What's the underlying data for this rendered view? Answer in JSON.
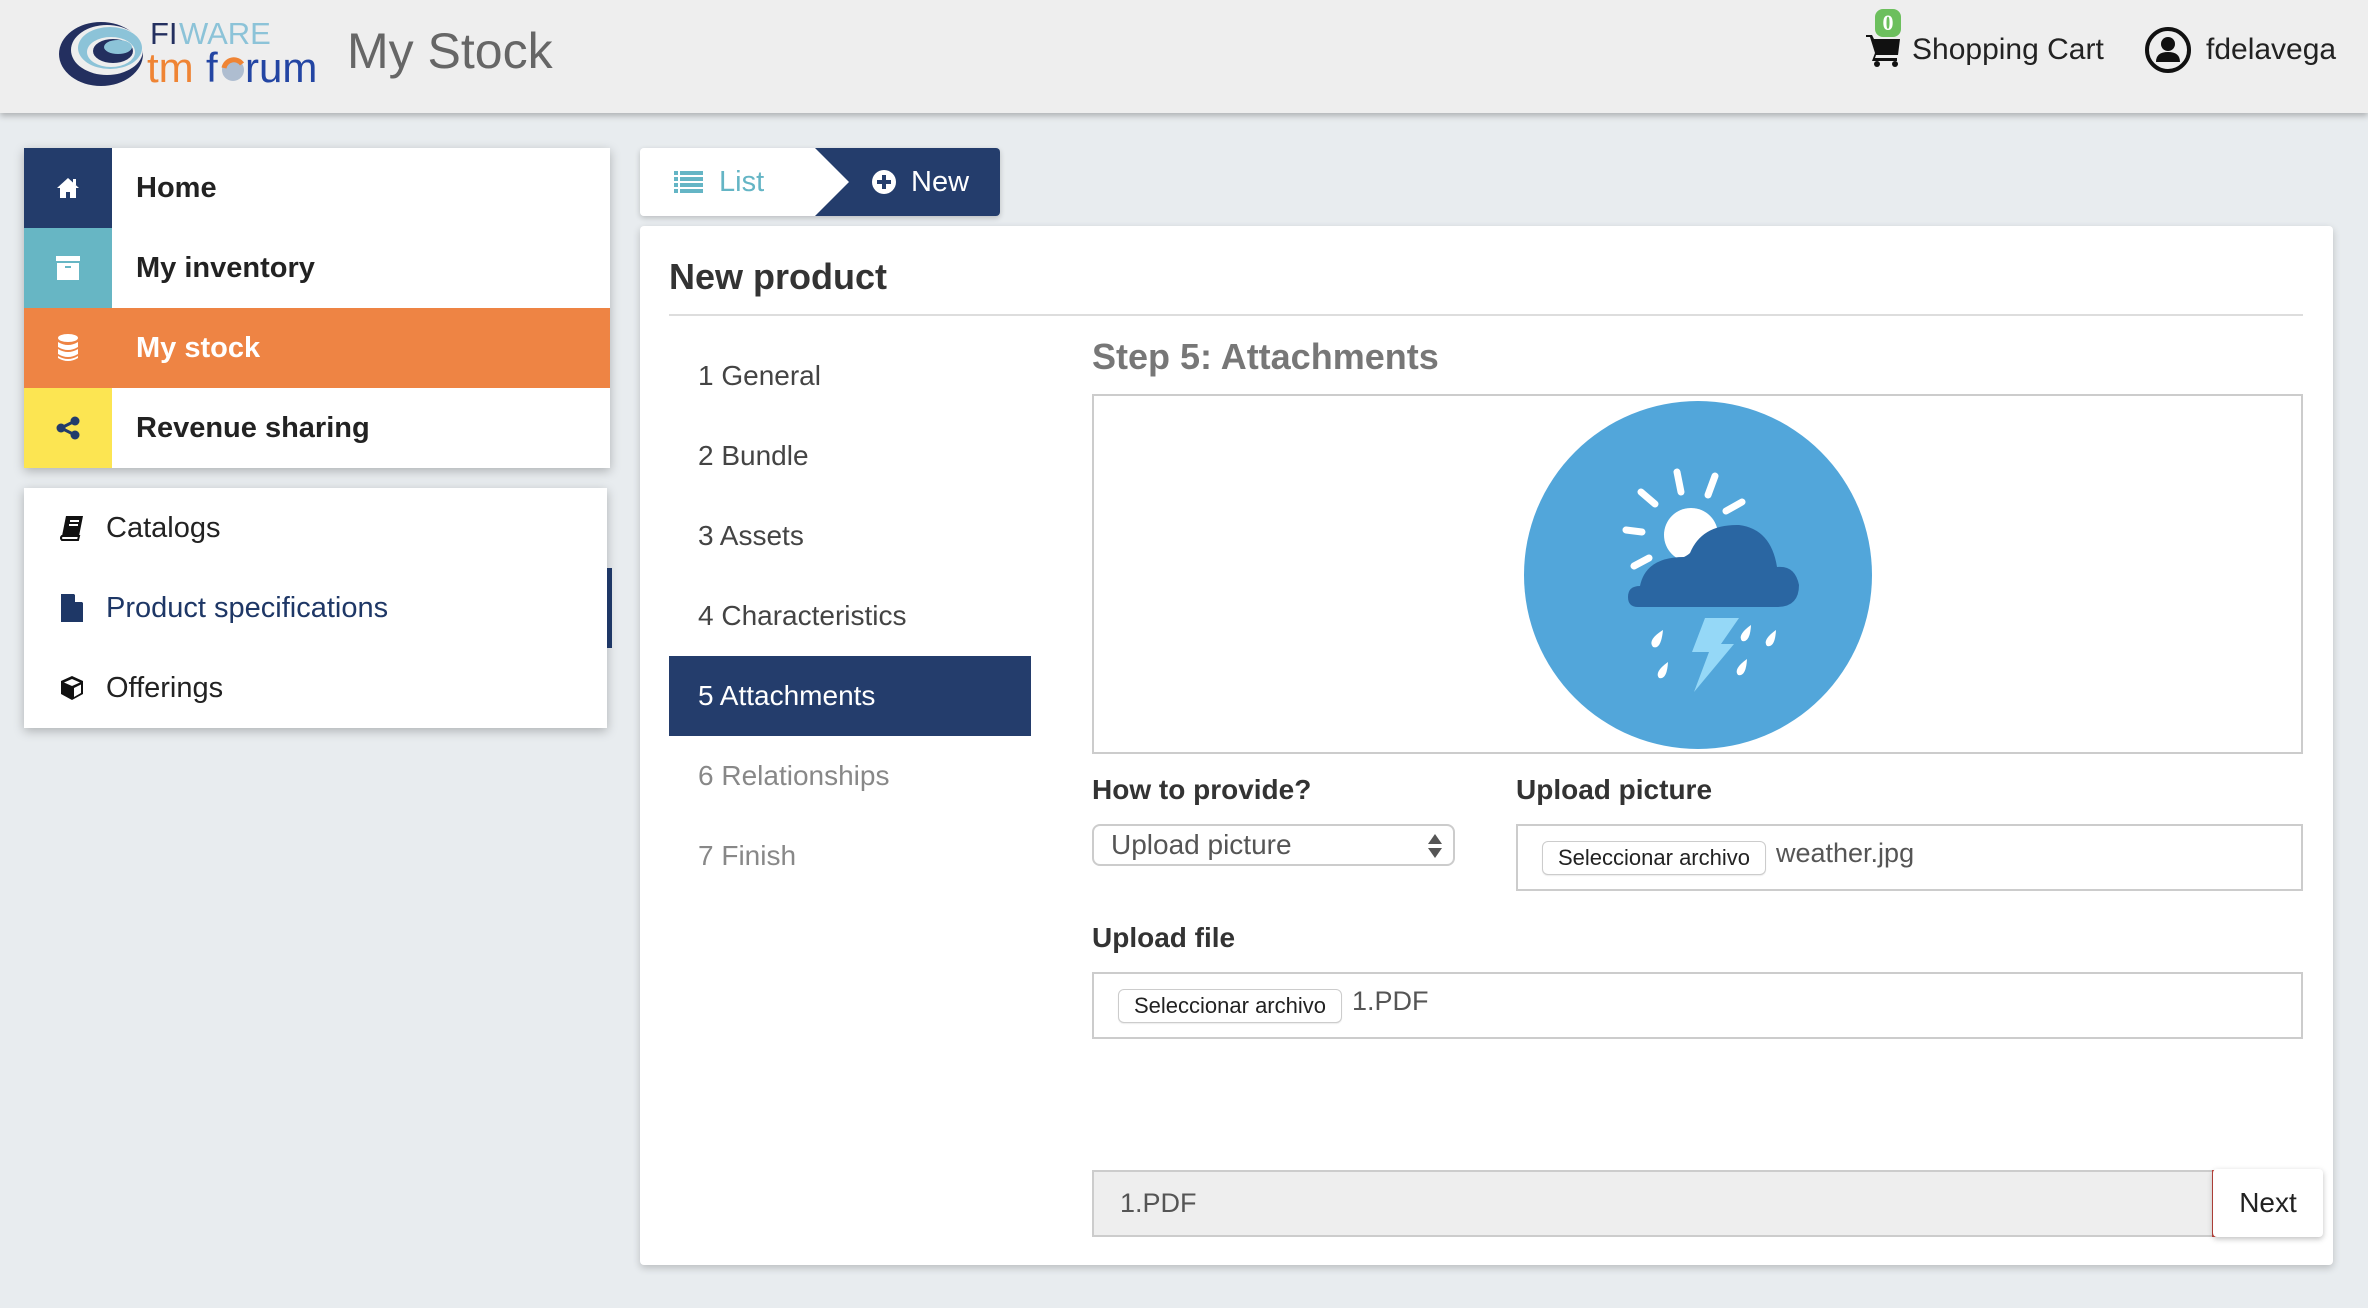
{
  "header": {
    "brand_top": "FIWARE",
    "brand_bottom": "tmforum",
    "app_title": "My Stock",
    "cart": {
      "label": "Shopping Cart",
      "count": "0",
      "icon": "shopping-cart-icon"
    },
    "user": {
      "name": "fdelavega",
      "icon": "user-circle-icon"
    }
  },
  "sidebar": {
    "main_items": [
      {
        "label": "Home",
        "icon": "home-icon",
        "color": "#233c6b"
      },
      {
        "label": "My inventory",
        "icon": "archive-box-icon",
        "color": "#67b6c4"
      },
      {
        "label": "My stock",
        "icon": "database-icon",
        "color": "#ee8444",
        "active": true
      },
      {
        "label": "Revenue sharing",
        "icon": "share-icon",
        "color": "#fce552"
      }
    ],
    "sub_items": [
      {
        "label": "Catalogs",
        "icon": "book-icon"
      },
      {
        "label": "Product specifications",
        "icon": "file-icon",
        "active": true
      },
      {
        "label": "Offerings",
        "icon": "cube-icon"
      }
    ]
  },
  "tabs": {
    "list_label": "List",
    "new_label": "New"
  },
  "panel": {
    "title": "New product",
    "steps": [
      {
        "label": "1  General",
        "state": "done"
      },
      {
        "label": "2  Bundle",
        "state": "done"
      },
      {
        "label": "3  Assets",
        "state": "done"
      },
      {
        "label": "4  Characteristics",
        "state": "done"
      },
      {
        "label": "5  Attachments",
        "state": "active"
      },
      {
        "label": "6  Relationships",
        "state": "pending"
      },
      {
        "label": "7  Finish",
        "state": "pending"
      }
    ],
    "step_title": "Step 5: Attachments",
    "preview_alt": "weather-storm-image",
    "how_label": "How to provide?",
    "how_value": "Upload picture",
    "upload_picture_label": "Upload picture",
    "upload_picture_button": "Seleccionar archivo",
    "upload_picture_file": "weather.jpg",
    "upload_file_label": "Upload file",
    "upload_file_button": "Seleccionar archivo",
    "upload_file_file": "1.PDF",
    "attachments": [
      {
        "name": "1.PDF"
      }
    ],
    "next_label": "Next"
  },
  "colors": {
    "navy": "#243d6c",
    "orange": "#ee8444",
    "teal": "#67b6c4",
    "yellow": "#fce552",
    "danger": "#c9584f",
    "badge_green": "#6cbf5d"
  }
}
